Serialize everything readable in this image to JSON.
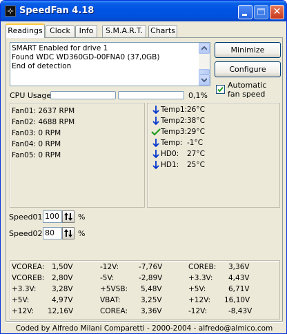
{
  "window": {
    "title": "SpeedFan 4.18"
  },
  "tabs": [
    {
      "label": "Readings",
      "active": true
    },
    {
      "label": "Clock"
    },
    {
      "label": "Info"
    },
    {
      "label": "S.M.A.R.T."
    },
    {
      "label": "Charts"
    }
  ],
  "log": {
    "lines": [
      "SMART Enabled for drive 1",
      "Found WDC WD360GD-00FNA0 (37,0GB)",
      "End of detection"
    ]
  },
  "buttons": {
    "minimize": "Minimize",
    "configure": "Configure"
  },
  "auto_fan": {
    "label": "Automatic fan speed",
    "checked": true
  },
  "cpu": {
    "label": "CPU Usage",
    "value": "0,1%",
    "fraction": 0.001
  },
  "fans": [
    {
      "name": "Fan01:",
      "value": "2637 RPM"
    },
    {
      "name": "Fan02:",
      "value": "4688 RPM"
    },
    {
      "name": "Fan03:",
      "value": "0 RPM"
    },
    {
      "name": "Fan04:",
      "value": "0 RPM"
    },
    {
      "name": "Fan05:",
      "value": "0 RPM"
    }
  ],
  "temps": [
    {
      "name": "Temp1:",
      "value": "26°C",
      "icon": "arrow-down-icon"
    },
    {
      "name": "Temp2:",
      "value": "38°C",
      "icon": "arrow-down-icon"
    },
    {
      "name": "Temp3:",
      "value": "29°C",
      "icon": "check-icon"
    },
    {
      "name": "Temp:",
      "value": "-1°C",
      "icon": "arrow-down-icon"
    },
    {
      "name": "HD0:",
      "value": "27°C",
      "icon": "arrow-down-icon"
    },
    {
      "name": "HD1:",
      "value": "25°C",
      "icon": "arrow-down-icon"
    }
  ],
  "speeds": [
    {
      "label": "Speed01:",
      "value": "100",
      "unit": "%"
    },
    {
      "label": "Speed02:",
      "value": "80",
      "unit": "%"
    }
  ],
  "voltages": [
    [
      {
        "name": "VCOREA:",
        "value": "1,50V"
      },
      {
        "name": "VCOREB:",
        "value": "2,80V"
      },
      {
        "name": "+3.3V:",
        "value": "3,28V"
      },
      {
        "name": "+5V:",
        "value": "4,97V"
      },
      {
        "name": "+12V:",
        "value": "12,16V"
      }
    ],
    [
      {
        "name": "-12V:",
        "value": "-7,76V"
      },
      {
        "name": "-5V:",
        "value": "-2,89V"
      },
      {
        "name": "+5VSB:",
        "value": "5,48V"
      },
      {
        "name": "VBAT:",
        "value": "3,25V"
      },
      {
        "name": "COREA:",
        "value": "3,36V"
      }
    ],
    [
      {
        "name": "COREB:",
        "value": "3,36V"
      },
      {
        "name": "+3.3V:",
        "value": "4,43V"
      },
      {
        "name": "+5V:",
        "value": "6,71V"
      },
      {
        "name": "+12V:",
        "value": "16,10V"
      },
      {
        "name": "-12V:",
        "value": "-8,43V"
      }
    ]
  ],
  "status": "Coded by Alfredo Milani Comparetti - 2000-2004 - alfredo@almico.com",
  "colors": {
    "titlebar": "#0054e3",
    "arrow_blue": "#0033cc",
    "check_green": "#1a9c1a",
    "tab_highlight": "#ffc83c"
  }
}
